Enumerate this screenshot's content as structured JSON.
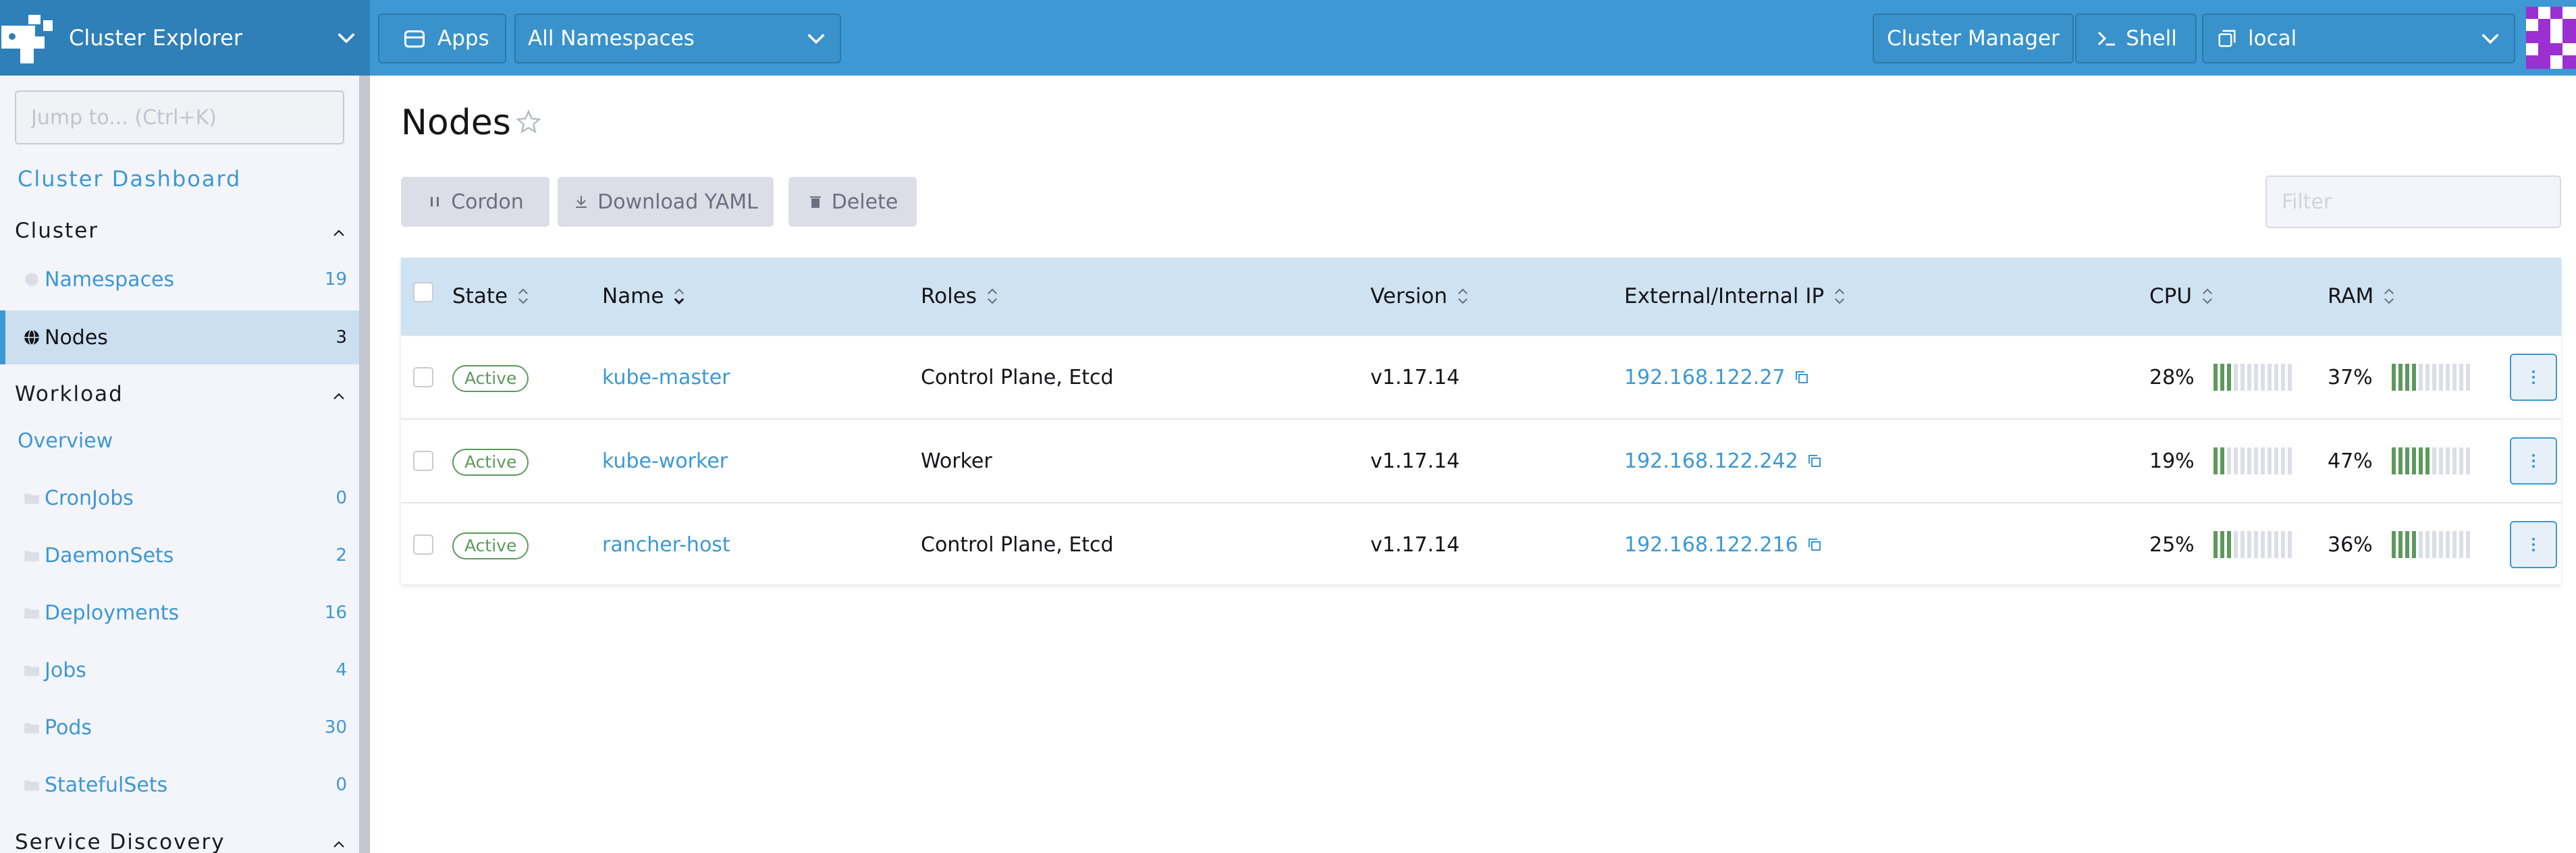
{
  "header": {
    "cluster_title": "Cluster Explorer",
    "apps_label": "Apps",
    "namespace_select": "All Namespaces",
    "cluster_manager_label": "Cluster Manager",
    "shell_label": "Shell",
    "cluster_select": "local",
    "icons": [
      "rancher-logo-icon",
      "chevron-down-icon",
      "apps-icon",
      "shell-icon",
      "cluster-icon",
      "user-avatar"
    ]
  },
  "sidebar": {
    "jump_placeholder": "Jump to... (Ctrl+K)",
    "dashboard_link": "Cluster Dashboard",
    "groups": [
      {
        "title": "Cluster",
        "items": [
          {
            "label": "Namespaces",
            "count": "19",
            "active": false
          },
          {
            "label": "Nodes",
            "count": "3",
            "active": true
          }
        ]
      },
      {
        "title": "Workload",
        "overview": "Overview",
        "items": [
          {
            "label": "CronJobs",
            "count": "0"
          },
          {
            "label": "DaemonSets",
            "count": "2"
          },
          {
            "label": "Deployments",
            "count": "16"
          },
          {
            "label": "Jobs",
            "count": "4"
          },
          {
            "label": "Pods",
            "count": "30"
          },
          {
            "label": "StatefulSets",
            "count": "0"
          }
        ]
      },
      {
        "title": "Service Discovery"
      }
    ]
  },
  "main": {
    "title": "Nodes",
    "actions": {
      "cordon": "Cordon",
      "download_yaml": "Download YAML",
      "delete": "Delete"
    },
    "filter_placeholder": "Filter",
    "table": {
      "columns": [
        "State",
        "Name",
        "Roles",
        "Version",
        "External/Internal IP",
        "CPU",
        "RAM"
      ],
      "rows": [
        {
          "state": "Active",
          "name": "kube-master",
          "roles": "Control Plane, Etcd",
          "version": "v1.17.14",
          "ip": "192.168.122.27",
          "cpu_label": "28%",
          "cpu": 0.28,
          "ram_label": "37%",
          "ram": 0.37
        },
        {
          "state": "Active",
          "name": "kube-worker",
          "roles": "Worker",
          "version": "v1.17.14",
          "ip": "192.168.122.242",
          "cpu_label": "19%",
          "cpu": 0.19,
          "ram_label": "47%",
          "ram": 0.47
        },
        {
          "state": "Active",
          "name": "rancher-host",
          "roles": "Control Plane, Etcd",
          "version": "v1.17.14",
          "ip": "192.168.122.216",
          "cpu_label": "25%",
          "cpu": 0.25,
          "ram_label": "36%",
          "ram": 0.36
        }
      ]
    }
  },
  "colors": {
    "accent": "#3d98d3",
    "header_bg": "#3d98d3",
    "active_green": "#5d995d"
  }
}
